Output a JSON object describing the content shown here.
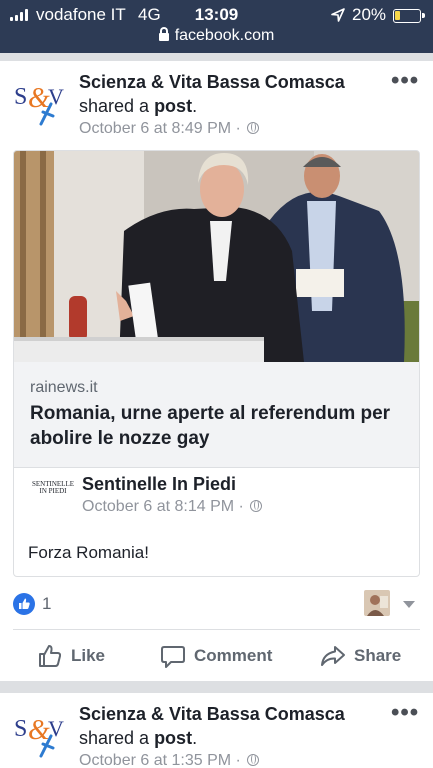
{
  "status_bar": {
    "carrier": "vodafone IT",
    "network": "4G",
    "time": "13:09",
    "battery_percent": "20%",
    "battery_level": 0.2,
    "battery_color": "#f7d84a"
  },
  "url_bar": {
    "domain": "facebook.com"
  },
  "colors": {
    "header_bg": "#2d3b55",
    "like_blue": "#2b73e6"
  },
  "posts": [
    {
      "author": "Scienza & Vita Bassa Comasca",
      "action_prefix": "shared a ",
      "action_object": "post",
      "action_suffix": ".",
      "timestamp": "October 6 at 8:49 PM ·",
      "shared": {
        "link_domain": "rainews.it",
        "link_title": "Romania, urne aperte al referendum per abolire le nozze gay",
        "original_author": "Sentinelle In Piedi",
        "original_logo_text": "SENTINELLE IN PIEDI",
        "original_timestamp": "October 6 at 8:14 PM ·",
        "original_text": "Forza Romania!"
      },
      "reactions": {
        "count": "1"
      },
      "actions": {
        "like": "Like",
        "comment": "Comment",
        "share": "Share"
      }
    },
    {
      "author": "Scienza & Vita Bassa Comasca",
      "action_prefix": "shared a ",
      "action_object": "post",
      "action_suffix": ".",
      "timestamp": "October 6 at 1:35 PM ·"
    }
  ]
}
